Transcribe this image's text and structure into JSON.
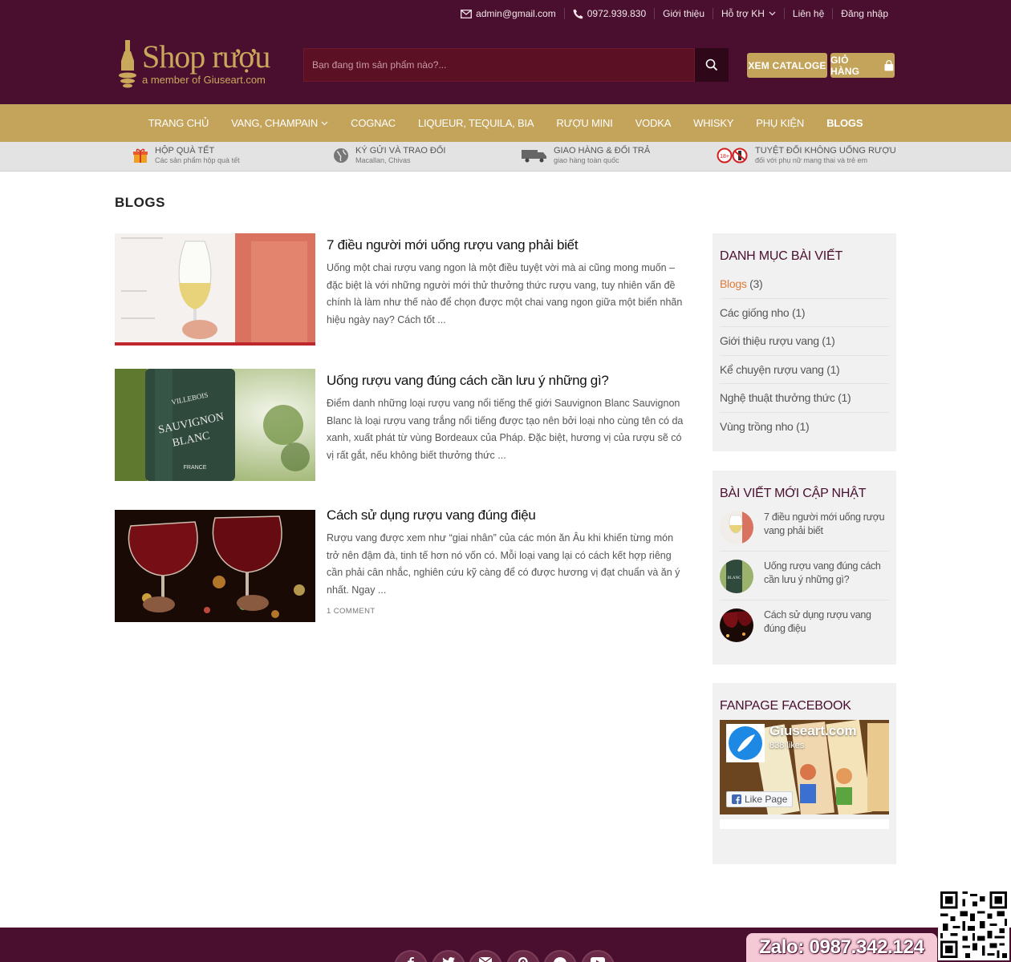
{
  "header": {
    "email": "admin@gmail.com",
    "phone": "0972.939.830",
    "links": [
      "Giới thiệu",
      "Hỗ trợ KH",
      "Liên hệ",
      "Đăng nhập"
    ],
    "logo_name": "Shop rượu",
    "logo_sub": "a member of Giuseart.com",
    "search_placeholder": "Bạn đang tìm sản phẩm nào?...",
    "catalog_label": "XEM CATALOGE",
    "cart_label": "GIỎ HÀNG",
    "colors": {
      "bg": "#4a0f2f",
      "gold": "#c4a35a"
    }
  },
  "nav": {
    "items": [
      "TRANG CHỦ",
      "VANG, CHAMPAIN",
      "COGNAC",
      "LIQUEUR, TEQUILA, BIA",
      "RƯỢU MINI",
      "VODKA",
      "WHISKY",
      "PHỤ KIỆN",
      "BLOGS"
    ],
    "active": "BLOGS"
  },
  "features": [
    {
      "title": "HỘP QUÀ TẾT",
      "sub": "Các sản phẩm hộp quà tết",
      "icon": "gift-icon"
    },
    {
      "title": "KÝ GỬI VÀ TRAO ĐỔI",
      "sub": "Macallan, Chivas",
      "icon": "globe-icon"
    },
    {
      "title": "GIAO HÀNG & ĐỔI TRẢ",
      "sub": "giao hàng toàn quốc",
      "icon": "truck-icon"
    },
    {
      "title": "TUYỆT ĐỐI KHÔNG UỐNG RƯỢU",
      "sub": "đối với phụ nữ mang thai và trẻ em",
      "icon": "no-alcohol-icon"
    }
  ],
  "page_title": "BLOGS",
  "posts": [
    {
      "title": "7 điều người mới uống rượu vang phải biết",
      "excerpt": "Uống một chai rượu vang ngon là một điều tuyệt vời mà ai cũng mong muốn – đặc biệt là với những người mới thử thưởng thức rượu vang, tuy nhiên vấn đề chính là làm như thế nào để chọn được một chai vang ngon giữa một biển nhãn hiệu ngày nay? Cách tốt ...",
      "meta": ""
    },
    {
      "title": "Uống rượu vang đúng cách cần lưu ý những gì?",
      "excerpt": "Điểm danh những loại rượu vang nổi tiếng thế giới Sauvignon Blanc Sauvignon Blanc là loại rượu vang trắng nổi tiếng được tạo nên bởi loại nho cùng tên có da xanh, xuất phát từ vùng Bordeaux của Pháp. Đặc biệt, hương vị của rượu sẽ có vị rất gắt, nếu không biết thưởng thức ...",
      "meta": ""
    },
    {
      "title": "Cách sử dụng rượu vang đúng điệu",
      "excerpt": "Rượu vang được xem như “giai nhân” của các món ăn Âu khi khiến từng món trở nên đậm đà, tinh tế hơn nó vốn có. Mỗi loại vang lại có cách kết hợp riêng cần phải cân nhắc, nghiên cứu kỹ càng để có được hương vị đạt chuẩn và ăn ý nhất. Ngay ...",
      "meta": "1 COMMENT"
    }
  ],
  "sidebar": {
    "categories_title": "DANH MỤC BÀI VIẾT",
    "categories": [
      {
        "name": "Blogs",
        "count": "(3)"
      },
      {
        "name": "Các giống nho",
        "count": "(1)"
      },
      {
        "name": "Giới thiệu rượu vang",
        "count": "(1)"
      },
      {
        "name": "Kể chuyện rượu vang",
        "count": "(1)"
      },
      {
        "name": "Nghệ thuật thưởng thức",
        "count": "(1)"
      },
      {
        "name": "Vùng trồng nho",
        "count": "(1)"
      }
    ],
    "recent_title": "BÀI VIẾT MỚI CẬP NHẬT",
    "recent": [
      "7 điều người mới uống rượu vang phải biết",
      "Uống rượu vang đúng cách cần lưu ý những gì?",
      "Cách sử dụng rượu vang đúng điệu"
    ],
    "fb_title": "FANPAGE FACEBOOK",
    "fb_page_name": "Giuseart.com",
    "fb_likes": "838 likes",
    "fb_like_label": "Like Page"
  },
  "footer": {
    "zalo": "Zalo: 0987.342.124",
    "social_icons": [
      "facebook-icon",
      "twitter-icon",
      "email-icon",
      "pinterest-icon",
      "messenger-icon",
      "youtube-icon"
    ]
  }
}
